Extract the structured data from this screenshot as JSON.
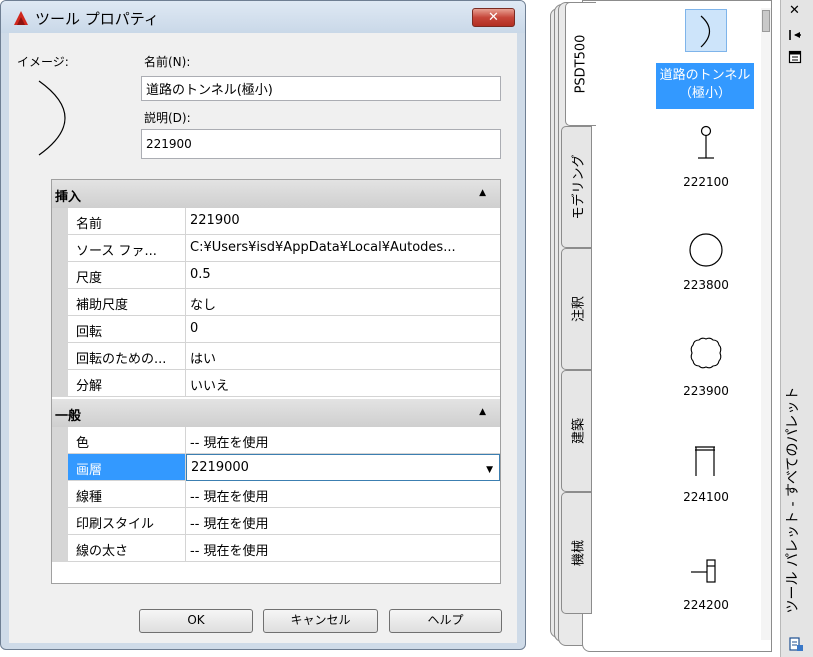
{
  "dialog": {
    "title": "ツール プロパティ",
    "close_label": "✕",
    "image_label": "イメージ:",
    "name_label": "名前(N):",
    "name_value": "道路のトンネル(極小)",
    "desc_label": "説明(D):",
    "desc_value": "221900",
    "categories": [
      {
        "label": "挿入",
        "arrow": "▲",
        "rows": [
          {
            "name": "名前",
            "value": "221900"
          },
          {
            "name": "ソース ファ...",
            "value": "C:¥Users¥isd¥AppData¥Local¥Autodes..."
          },
          {
            "name": "尺度",
            "value": "0.5"
          },
          {
            "name": "補助尺度",
            "value": "なし"
          },
          {
            "name": "回転",
            "value": "0"
          },
          {
            "name": "回転のための...",
            "value": "はい"
          },
          {
            "name": "分解",
            "value": "いいえ"
          }
        ]
      },
      {
        "label": "一般",
        "arrow": "▲",
        "rows": [
          {
            "name": "色",
            "value": "-- 現在を使用"
          },
          {
            "name": "画層",
            "value": "2219000",
            "dropdown": "▼"
          },
          {
            "name": "線種",
            "value": "-- 現在を使用"
          },
          {
            "name": "印刷スタイル",
            "value": "-- 現在を使用"
          },
          {
            "name": "線の太さ",
            "value": "-- 現在を使用"
          }
        ]
      }
    ],
    "buttons": {
      "ok": "OK",
      "cancel": "キャンセル",
      "help": "ヘルプ"
    }
  },
  "palette": {
    "tabs": [
      "PSDT500",
      "モデリング",
      "注釈",
      "建築",
      "機械"
    ],
    "tools": [
      {
        "label": "道路のトンネル（極小）",
        "icon": "arc-icon",
        "selected": true
      },
      {
        "label": "222100",
        "icon": "pin-icon"
      },
      {
        "label": "223800",
        "icon": "circle-icon"
      },
      {
        "label": "223900",
        "icon": "wavy-circle-icon"
      },
      {
        "label": "224100",
        "icon": "gate-icon"
      },
      {
        "label": "224200",
        "icon": "post-icon"
      }
    ],
    "side_title": "ツール パレット - すべてのパレット",
    "side_icons": [
      "close-icon",
      "autohide-icon",
      "properties-icon",
      "palette-menu-icon"
    ],
    "side_close": "✕"
  }
}
